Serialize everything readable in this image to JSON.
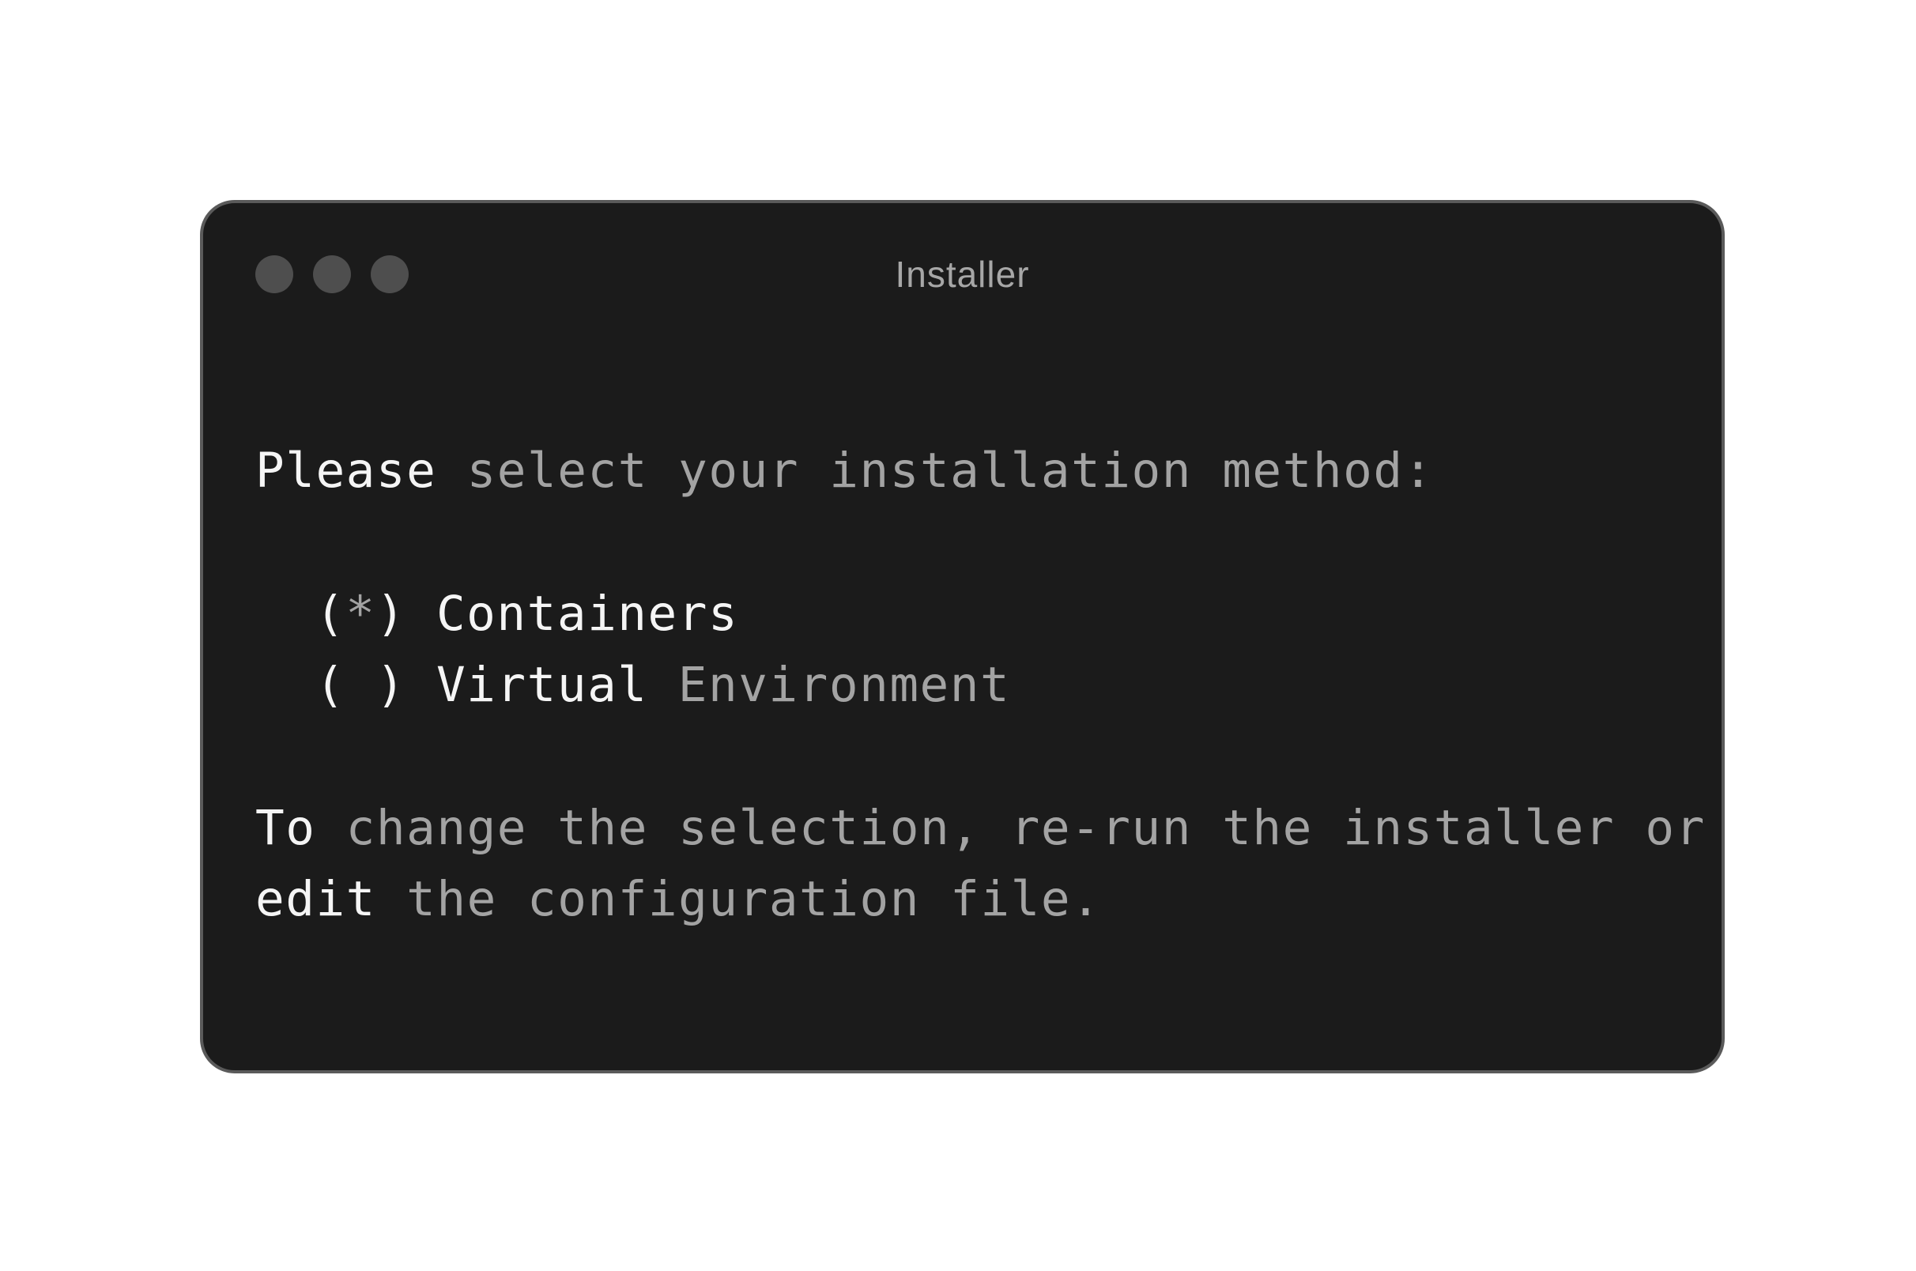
{
  "window": {
    "title": "Installer"
  },
  "prompt": {
    "bold": "Please",
    "rest": " select your installation method:"
  },
  "options": [
    {
      "open": "(",
      "mark": "*",
      "close": ")",
      "label_bold": "Containers",
      "label_rest": ""
    },
    {
      "open": "(",
      "mark": " ",
      "close": ")",
      "label_bold": "Virtual",
      "label_rest": " Environment"
    }
  ],
  "footer": {
    "line1_bold": "To",
    "line1_rest": " change the selection, re-run the installer or",
    "line2_bold": "edit",
    "line2_rest": " the configuration file."
  },
  "colors": {
    "background": "#ffffff",
    "window_bg": "#1b1b1b",
    "window_border": "#5a5a5a",
    "dot": "#4e4e4e",
    "text_bright": "#f5f5f5",
    "text_dim": "#a3a3a3"
  }
}
